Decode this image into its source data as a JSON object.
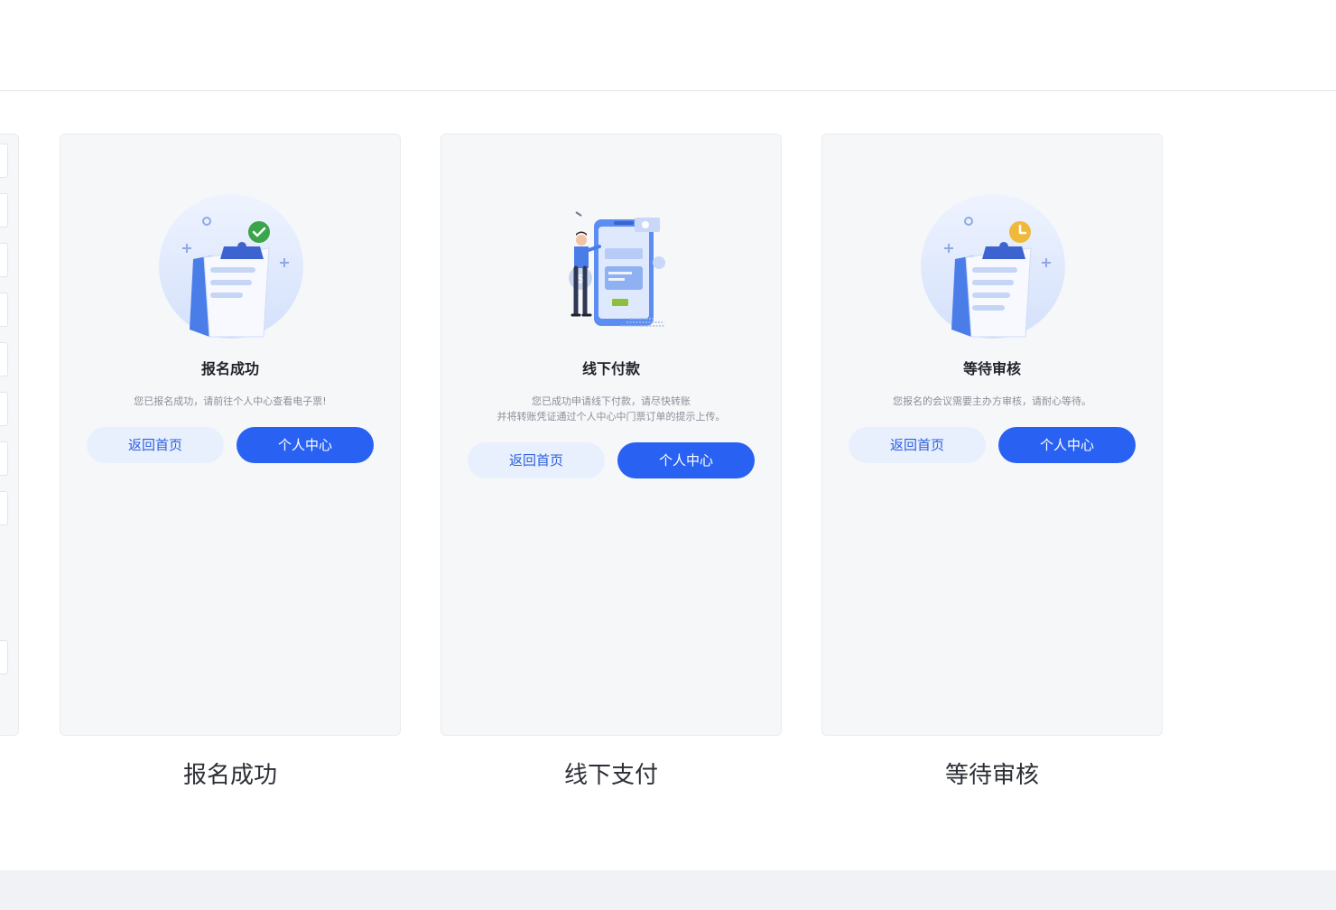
{
  "cards": [
    {
      "title": "报名成功",
      "description": "您已报名成功，请前往个人中心查看电子票!",
      "illustration": "clipboard-check-icon",
      "badge_color": "#3aa54a",
      "home_label": "返回首页",
      "center_label": "个人中心",
      "caption": "报名成功"
    },
    {
      "title": "线下付款",
      "description": "您已成功申请线下付款，请尽快转账\n并将转账凭证通过个人中心中门票订单的提示上传。",
      "illustration": "offline-payment-phone-icon",
      "home_label": "返回首页",
      "center_label": "个人中心",
      "caption": "线下支付"
    },
    {
      "title": "等待审核",
      "description": "您报名的会议需要主办方审核，请耐心等待。",
      "illustration": "clipboard-clock-icon",
      "badge_color": "#f0b93a",
      "home_label": "返回首页",
      "center_label": "个人中心",
      "caption": "等待审核"
    }
  ],
  "colors": {
    "primary": "#2962f3",
    "primary_soft": "#e9f0fd",
    "card_bg": "#f6f7f9"
  }
}
